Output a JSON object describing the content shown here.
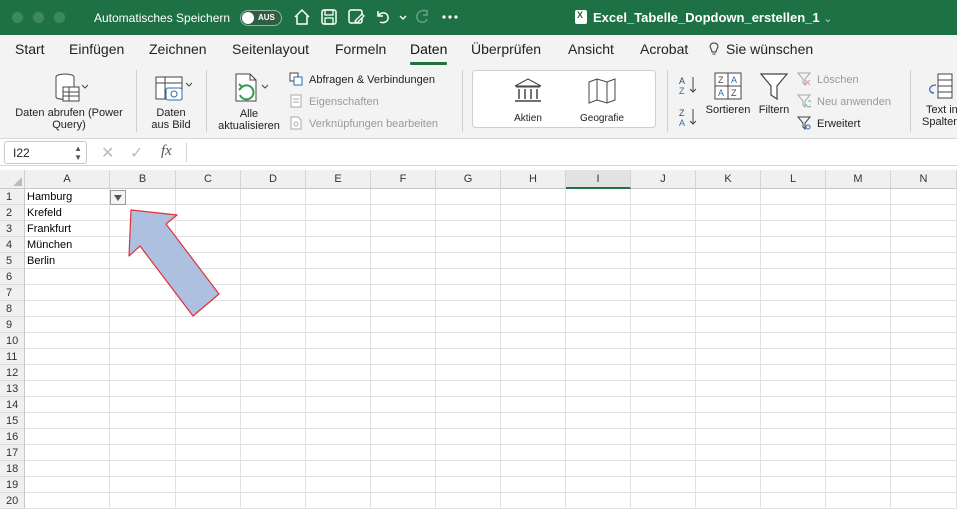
{
  "titlebar": {
    "autosave_label": "Automatisches Speichern",
    "autosave_state": "AUS",
    "doc_title": "Excel_Tabelle_Dopdown_erstellen_1",
    "icons": [
      "home-icon",
      "save-icon",
      "edit-save-icon",
      "undo-icon",
      "redo-icon",
      "more-icon"
    ],
    "accent": "#1e7145"
  },
  "tabs": [
    "Start",
    "Einfügen",
    "Zeichnen",
    "Seitenlayout",
    "Formeln",
    "Daten",
    "Überprüfen",
    "Ansicht",
    "Acrobat",
    "Sie wünschen"
  ],
  "active_tab": "Daten",
  "ribbon": {
    "get_data": "Daten abrufen (Power Query)",
    "get_data_l1": "Daten abrufen (Power",
    "get_data_l2": "Query)",
    "from_picture_l1": "Daten",
    "from_picture_l2": "aus Bild",
    "refresh_l1": "Alle",
    "refresh_l2": "aktualisieren",
    "queries": "Abfragen & Verbindungen",
    "properties": "Eigenschaften",
    "edit_links": "Verknüpfungen bearbeiten",
    "stocks": "Aktien",
    "geography": "Geografie",
    "sort": "Sortieren",
    "filter": "Filtern",
    "clear": "Löschen",
    "reapply": "Neu anwenden",
    "advanced": "Erweitert",
    "text_columns_l1": "Text in",
    "text_columns_l2": "Spalten"
  },
  "formula_bar": {
    "name_box": "I22",
    "fx": "fx",
    "value": ""
  },
  "grid": {
    "columns": [
      "A",
      "B",
      "C",
      "D",
      "E",
      "F",
      "G",
      "H",
      "I",
      "J",
      "K",
      "L",
      "M",
      "N"
    ],
    "selected_column": "I",
    "rows": [
      "1",
      "2",
      "3",
      "4",
      "5",
      "6",
      "7",
      "8",
      "9",
      "10",
      "11",
      "12",
      "13",
      "14",
      "15",
      "16",
      "17",
      "18",
      "19",
      "20"
    ],
    "cells_A": [
      "Hamburg",
      "Krefeld",
      "Frankfurt",
      "München",
      "Berlin"
    ],
    "annotation": {
      "arrow_color": "#aec0e0",
      "arrow_border": "#e0303a"
    }
  }
}
